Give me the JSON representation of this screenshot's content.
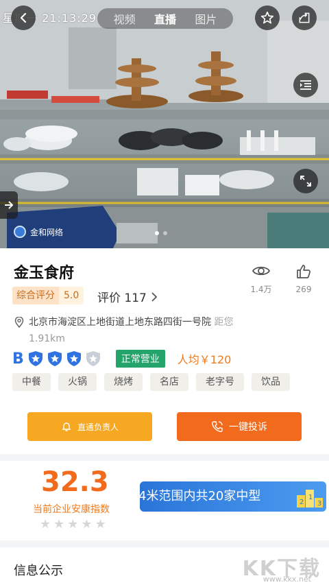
{
  "feed": {
    "timestamp": "星期一  21:13:29",
    "tabs": [
      "视频",
      "直播",
      "图片"
    ],
    "active_tab": "直播",
    "provider": "金和网络",
    "carousel_index": 1,
    "carousel_count": 2
  },
  "restaurant": {
    "name": "金玉食府",
    "score_label": "综合评分",
    "score_value": "5.0",
    "reviews_label": "评价 117",
    "views": "1.4万",
    "likes": "269",
    "address": "北京市海淀区上地街道上地东路四街一号院",
    "distance_label": "距您",
    "distance": "1.91km",
    "credit_letter": "B",
    "credit_stars": 3,
    "credit_max": 4,
    "status": "正常营业",
    "avg_price": "人均￥120",
    "tags": [
      "中餐",
      "火锅",
      "烧烤",
      "名店",
      "老字号",
      "饮品"
    ]
  },
  "actions": {
    "contact_label": "直通负责人",
    "complaint_label": "一键投诉"
  },
  "index": {
    "value": "32.3",
    "label": "当前企业安康指数",
    "stars_filled": 0,
    "stars_total": 5,
    "banner_text": "4米范围内共20家中型"
  },
  "section": {
    "title": "信息公示"
  },
  "overlay": {
    "watermark": "KK下载",
    "url": "www.kkx.net"
  },
  "colors": {
    "accent_orange": "#f26b1d",
    "accent_yellow": "#f7a823",
    "status_green": "#24a36a",
    "credit_blue": "#2f73e0"
  }
}
